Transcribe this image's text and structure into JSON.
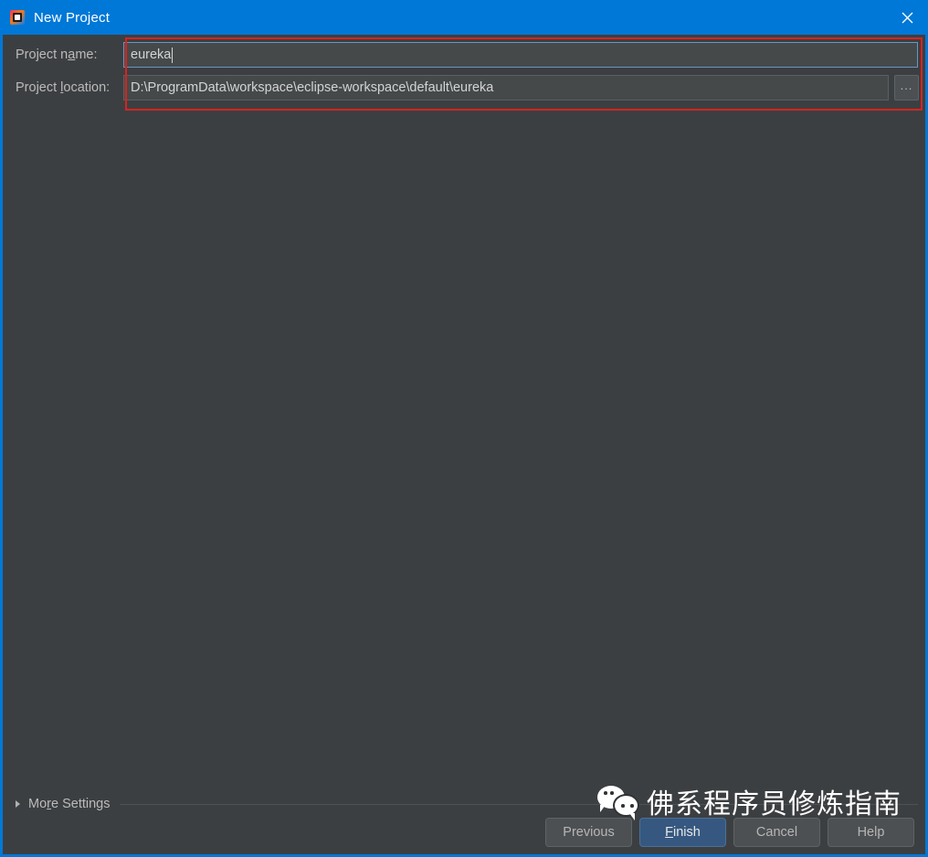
{
  "window": {
    "title": "New Project",
    "app_icon": "intellij-idea-icon",
    "close_icon": "close-icon",
    "accent_color": "#0078d7",
    "background_color": "#3c3f41"
  },
  "form": {
    "project_name": {
      "label_pre": "Project n",
      "label_mnemonic": "a",
      "label_post": "me:",
      "value": "eureka",
      "placeholder": ""
    },
    "project_location": {
      "label_pre": "Project ",
      "label_mnemonic": "l",
      "label_post": "ocation:",
      "value": "D:\\ProgramData\\workspace\\eclipse-workspace\\default\\eureka",
      "placeholder": "",
      "browse_label": "..."
    },
    "annotation_color": "#d6241f"
  },
  "more_settings": {
    "label_pre": "Mo",
    "label_mnemonic": "r",
    "label_post": "e Settings",
    "expanded": false
  },
  "buttons": {
    "previous": "Previous",
    "finish_pre": "",
    "finish_mnemonic": "F",
    "finish_post": "inish",
    "cancel": "Cancel",
    "help": "Help",
    "default_button_color": "#365880"
  },
  "watermark": {
    "logo": "wechat-icon",
    "text": "佛系程序员修炼指南"
  }
}
